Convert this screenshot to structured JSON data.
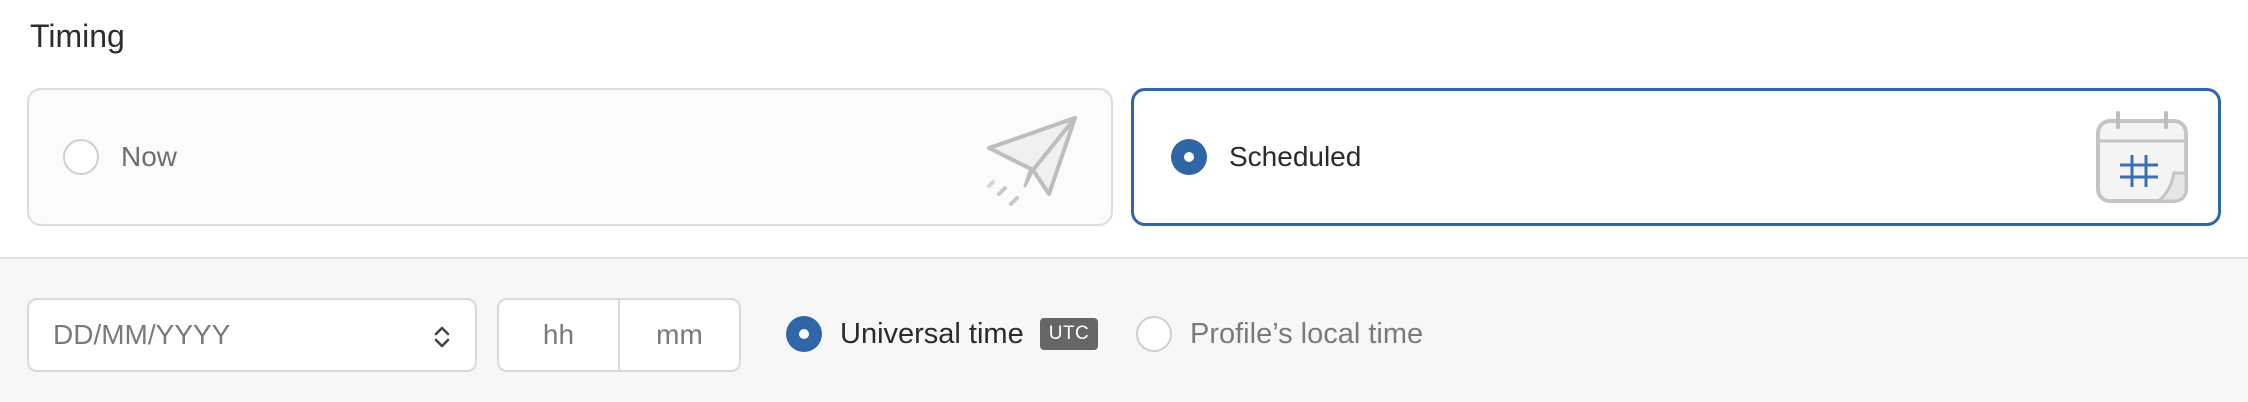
{
  "timing": {
    "title": "Timing",
    "options": [
      {
        "label": "Now",
        "selected": false,
        "icon": "paper-plane-icon"
      },
      {
        "label": "Scheduled",
        "selected": true,
        "icon": "calendar-icon"
      }
    ]
  },
  "schedule": {
    "date": {
      "placeholder": "DD/MM/YYYY",
      "icon": "chevron-up-down-icon"
    },
    "time": {
      "hours_placeholder": "hh",
      "minutes_placeholder": "mm"
    },
    "timezone": {
      "universal": {
        "label": "Universal time",
        "badge": "UTC",
        "selected": true
      },
      "local": {
        "label": "Profile’s local time",
        "selected": false
      }
    }
  },
  "colors": {
    "accent": "#2f66a6",
    "border": "#dcdcdc",
    "muted_text": "#7a7a7a",
    "badge_bg": "#666666"
  }
}
